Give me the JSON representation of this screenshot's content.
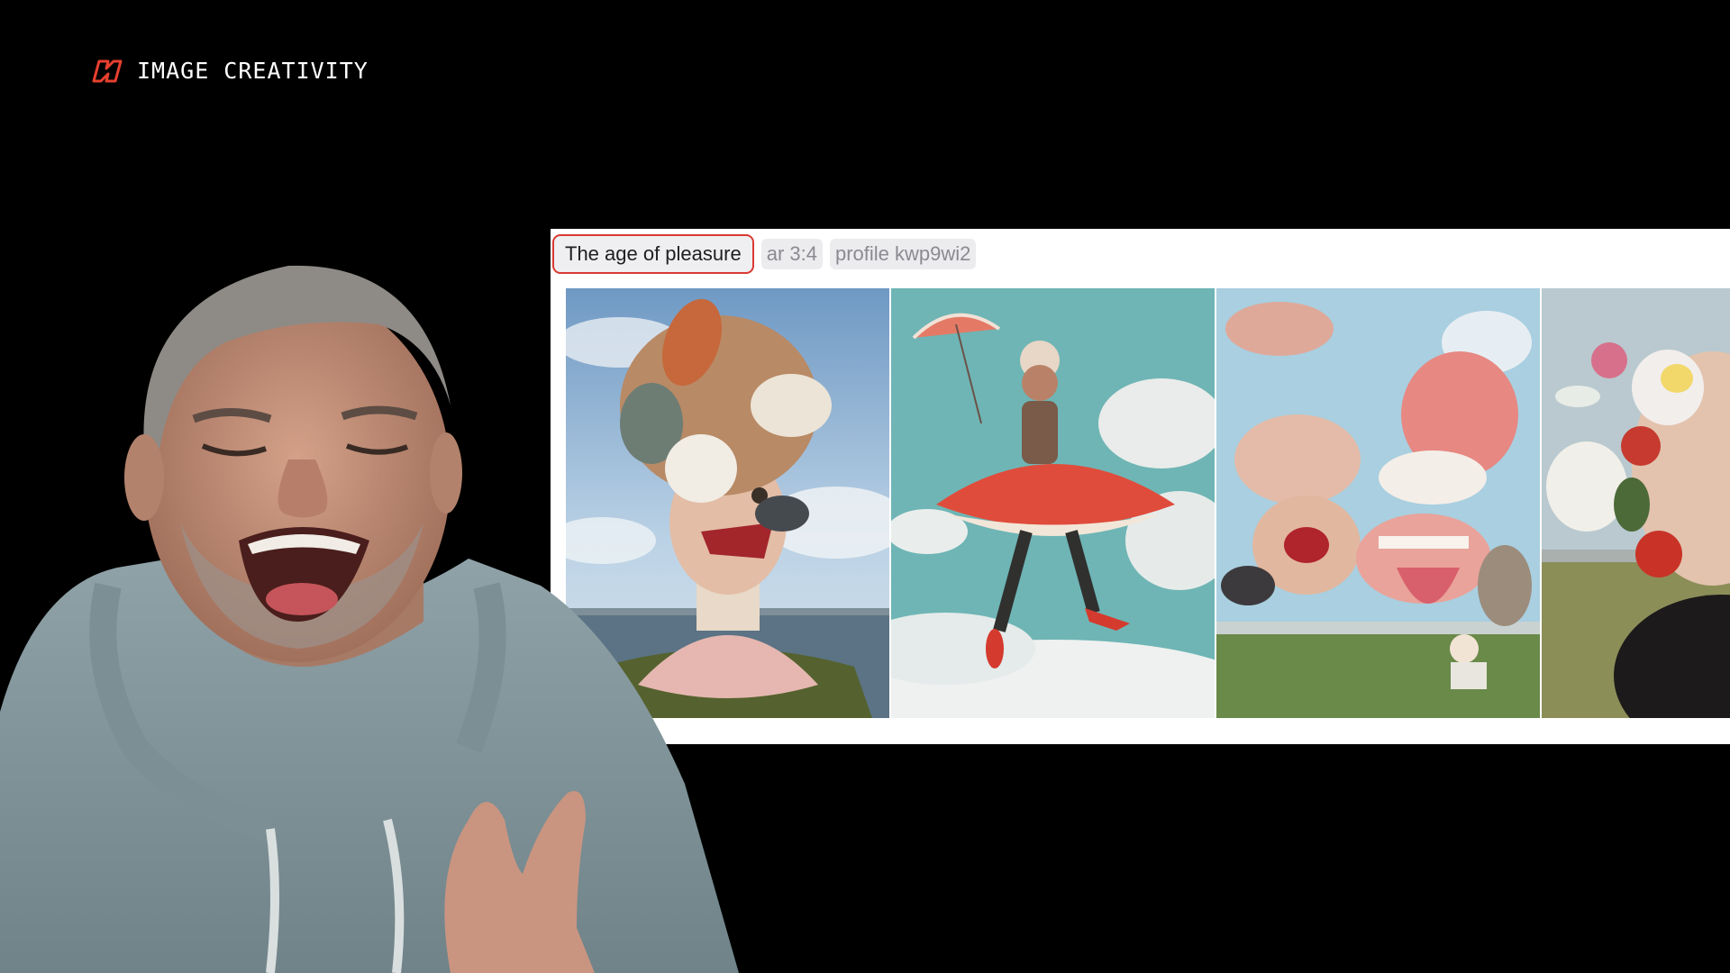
{
  "brand": {
    "name": "IMAGE CREATIVITY",
    "logo_icon": "brand-logo-icon",
    "accent": "#e8402f"
  },
  "prompt": {
    "text": "The age of pleasure",
    "params": [
      "ar 3:4",
      "profile kwp9wi2"
    ],
    "highlight_color": "#d93a32"
  },
  "gallery": {
    "images": [
      "surreal portrait with seashells head",
      "woman floating with umbrella and red skirt",
      "surreal collage with open mouth and tongue",
      "woman with flowers over face (partially visible)"
    ]
  },
  "presenter": {
    "description": "presenter in gray hoodie"
  }
}
